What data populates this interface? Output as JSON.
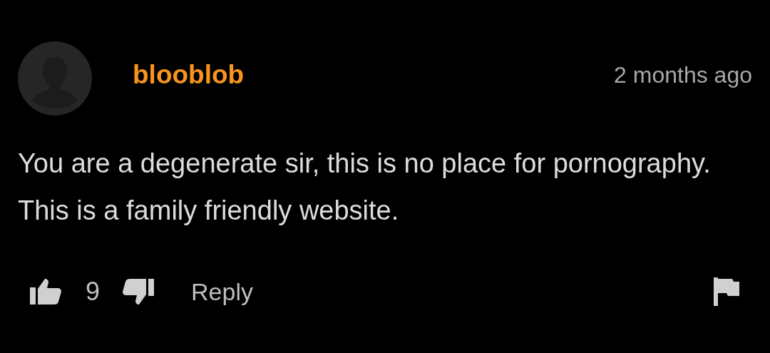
{
  "comment": {
    "username": "blooblob",
    "time": "2 months ago",
    "text": "You are a degenerate sir, this is no place for pornography. This is a family friendly website.",
    "likes": "9",
    "reply": "Reply"
  }
}
